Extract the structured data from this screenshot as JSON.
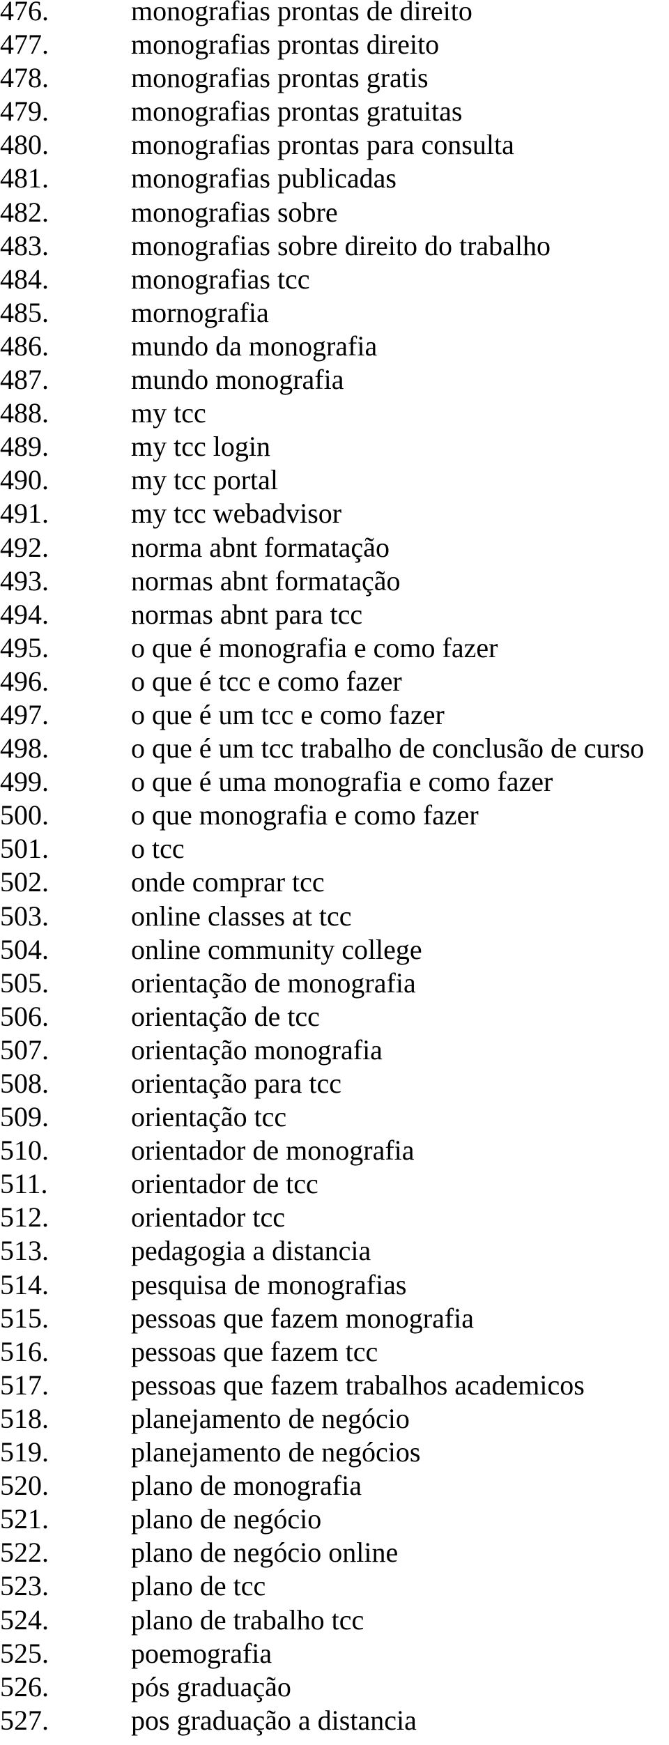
{
  "document": {
    "start_number": 476,
    "items": [
      {
        "number": "476.",
        "text": "monografias prontas de direito"
      },
      {
        "number": "477.",
        "text": "monografias prontas direito"
      },
      {
        "number": "478.",
        "text": "monografias prontas gratis"
      },
      {
        "number": "479.",
        "text": "monografias prontas gratuitas"
      },
      {
        "number": "480.",
        "text": "monografias prontas para consulta"
      },
      {
        "number": "481.",
        "text": "monografias publicadas"
      },
      {
        "number": "482.",
        "text": "monografias sobre"
      },
      {
        "number": "483.",
        "text": "monografias sobre direito do trabalho"
      },
      {
        "number": "484.",
        "text": "monografias tcc"
      },
      {
        "number": "485.",
        "text": "mornografia"
      },
      {
        "number": "486.",
        "text": "mundo da monografia"
      },
      {
        "number": "487.",
        "text": "mundo monografia"
      },
      {
        "number": "488.",
        "text": "my tcc"
      },
      {
        "number": "489.",
        "text": "my tcc login"
      },
      {
        "number": "490.",
        "text": "my tcc portal"
      },
      {
        "number": "491.",
        "text": "my tcc webadvisor"
      },
      {
        "number": "492.",
        "text": "norma abnt formatação"
      },
      {
        "number": "493.",
        "text": "normas abnt formatação"
      },
      {
        "number": "494.",
        "text": "normas abnt para tcc"
      },
      {
        "number": "495.",
        "text": "o que é monografia e como fazer"
      },
      {
        "number": "496.",
        "text": "o que é tcc e como fazer"
      },
      {
        "number": "497.",
        "text": "o que é um tcc e como fazer"
      },
      {
        "number": "498.",
        "text": "o que é um tcc trabalho de conclusão de curso"
      },
      {
        "number": "499.",
        "text": "o que é uma monografia e como fazer"
      },
      {
        "number": "500.",
        "text": "o que monografia e como fazer"
      },
      {
        "number": "501.",
        "text": "o tcc"
      },
      {
        "number": "502.",
        "text": "onde comprar tcc"
      },
      {
        "number": "503.",
        "text": "online classes at tcc"
      },
      {
        "number": "504.",
        "text": "online community college"
      },
      {
        "number": "505.",
        "text": "orientação de monografia"
      },
      {
        "number": "506.",
        "text": "orientação de tcc"
      },
      {
        "number": "507.",
        "text": "orientação monografia"
      },
      {
        "number": "508.",
        "text": "orientação para tcc"
      },
      {
        "number": "509.",
        "text": "orientação tcc"
      },
      {
        "number": "510.",
        "text": "orientador de monografia"
      },
      {
        "number": "511.",
        "text": "orientador de tcc"
      },
      {
        "number": "512.",
        "text": "orientador tcc"
      },
      {
        "number": "513.",
        "text": "pedagogia a distancia"
      },
      {
        "number": "514.",
        "text": "pesquisa de monografias"
      },
      {
        "number": "515.",
        "text": "pessoas que fazem monografia"
      },
      {
        "number": "516.",
        "text": "pessoas que fazem tcc"
      },
      {
        "number": "517.",
        "text": "pessoas que fazem trabalhos academicos"
      },
      {
        "number": "518.",
        "text": "planejamento de negócio"
      },
      {
        "number": "519.",
        "text": "planejamento de negócios"
      },
      {
        "number": "520.",
        "text": "plano de monografia"
      },
      {
        "number": "521.",
        "text": "plano de negócio"
      },
      {
        "number": "522.",
        "text": "plano de negócio online"
      },
      {
        "number": "523.",
        "text": "plano de tcc"
      },
      {
        "number": "524.",
        "text": "plano de trabalho tcc"
      },
      {
        "number": "525.",
        "text": "poemografia"
      },
      {
        "number": "526.",
        "text": "pós graduação"
      },
      {
        "number": "527.",
        "text": "pos graduação a distancia"
      }
    ]
  }
}
